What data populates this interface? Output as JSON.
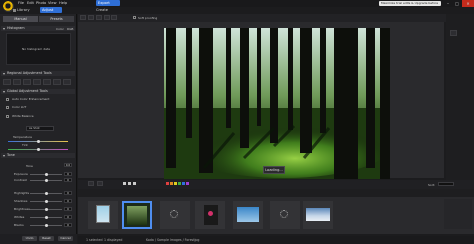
{
  "menu": [
    "File",
    "Edit",
    "Photo",
    "View",
    "Help"
  ],
  "modes": {
    "library": "Library",
    "adjust": "Adjust",
    "export": "Export",
    "create": "Create"
  },
  "notice": "Maximize trial edits & Upgrade before save",
  "left": {
    "tabs": [
      "Manual",
      "Presets"
    ],
    "histogram_label": "Histogram",
    "histogram_opts": [
      "Color",
      "RGB"
    ],
    "no_histogram": "No histogram data",
    "regional_label": "Regional Adjustment Tools",
    "global_label": "Global Adjustment Tools",
    "auto_color": "Auto Color Enhancement",
    "color_lut": "Color LUT",
    "white_balance": "White Balance",
    "wb_preset": "As Shot",
    "temperature": "Temperature",
    "tint": "Tint",
    "tone": "Tone",
    "tone_rows": [
      "Tone",
      "Exposure",
      "Contrast"
    ],
    "tone_values": [
      "0.0",
      "0",
      "0"
    ],
    "more_rows": [
      "Highlights",
      "Shadows",
      "Brightness",
      "Whites",
      "Blacks"
    ],
    "more_values": [
      "0",
      "0",
      "0",
      "0",
      "0"
    ],
    "footer": [
      "Undo",
      "Reset",
      "Cancel"
    ]
  },
  "view": {
    "zoom": "Soft proofing",
    "loading": "Loading...",
    "sort_label": "Sort:"
  },
  "status": {
    "selected": "1 selected",
    "displayed": "1 displayed",
    "path": "Koda / Sample Images / ForestJpg"
  },
  "colors": {
    "accent": "#2f6fd6",
    "tag_colors": [
      "#e04040",
      "#e08a20",
      "#e0d020",
      "#40b040",
      "#3070e0",
      "#a040d0"
    ]
  }
}
